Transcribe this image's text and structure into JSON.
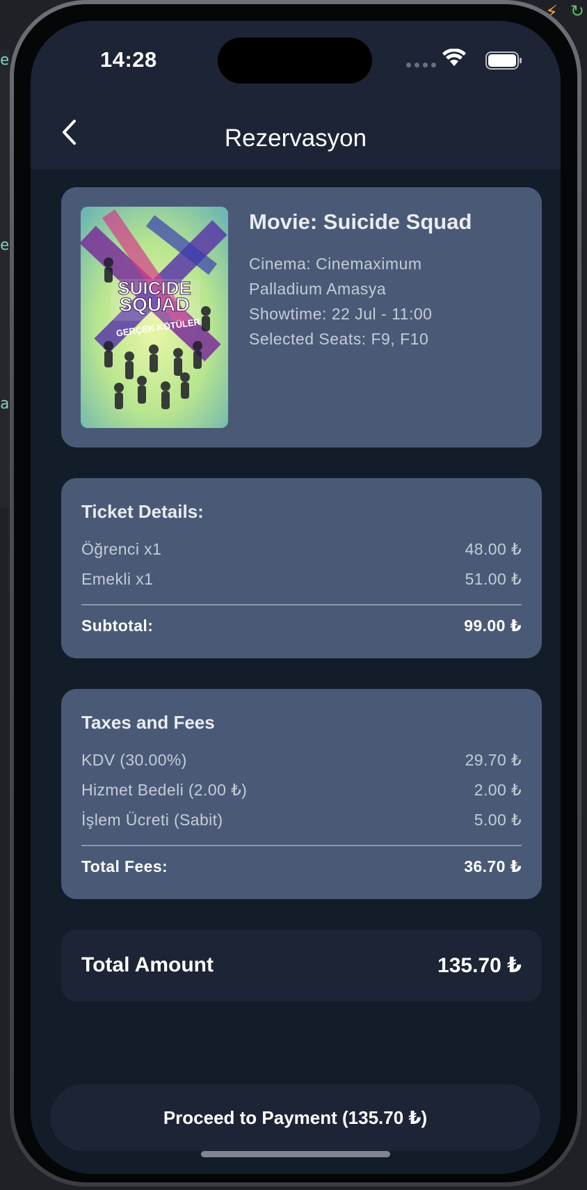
{
  "status_bar": {
    "time": "14:28"
  },
  "header": {
    "title": "Rezervasyon",
    "back_icon": "chevron-left-icon"
  },
  "movie": {
    "title": "Movie: Suicide Squad",
    "poster_text_line1": "SUICIDE",
    "poster_text_line2": "SQUAD",
    "poster_subtitle": "GERÇEK KÖTÜLER",
    "details": [
      "Cinema: Cinemaximum",
      "Palladium Amasya",
      "Showtime: 22 Jul - 11:00",
      "Selected Seats: F9, F10"
    ]
  },
  "ticket_details": {
    "heading": "Ticket Details:",
    "items": [
      {
        "label": "Öğrenci x1",
        "value": "48.00 ₺"
      },
      {
        "label": "Emekli x1",
        "value": "51.00 ₺"
      }
    ],
    "subtotal_label": "Subtotal:",
    "subtotal_value": "99.00 ₺"
  },
  "taxes_fees": {
    "heading": "Taxes and Fees",
    "items": [
      {
        "label": "KDV (30.00%)",
        "value": "29.70 ₺"
      },
      {
        "label": "Hizmet Bedeli (2.00 ₺)",
        "value": "2.00 ₺"
      },
      {
        "label": "İşlem Ücreti (Sabit)",
        "value": "5.00 ₺"
      }
    ],
    "total_label": "Total Fees:",
    "total_value": "36.70 ₺"
  },
  "summary": {
    "label": "Total Amount",
    "value": "135.70 ₺"
  },
  "actions": {
    "proceed_label": "Proceed to Payment (135.70 ₺)"
  },
  "colors": {
    "screen_bg": "#131c29",
    "bar_bg": "#1c2435",
    "card_bg": "#4a5a76",
    "text_primary": "#ffffff",
    "text_secondary": "#c5ccd8"
  }
}
